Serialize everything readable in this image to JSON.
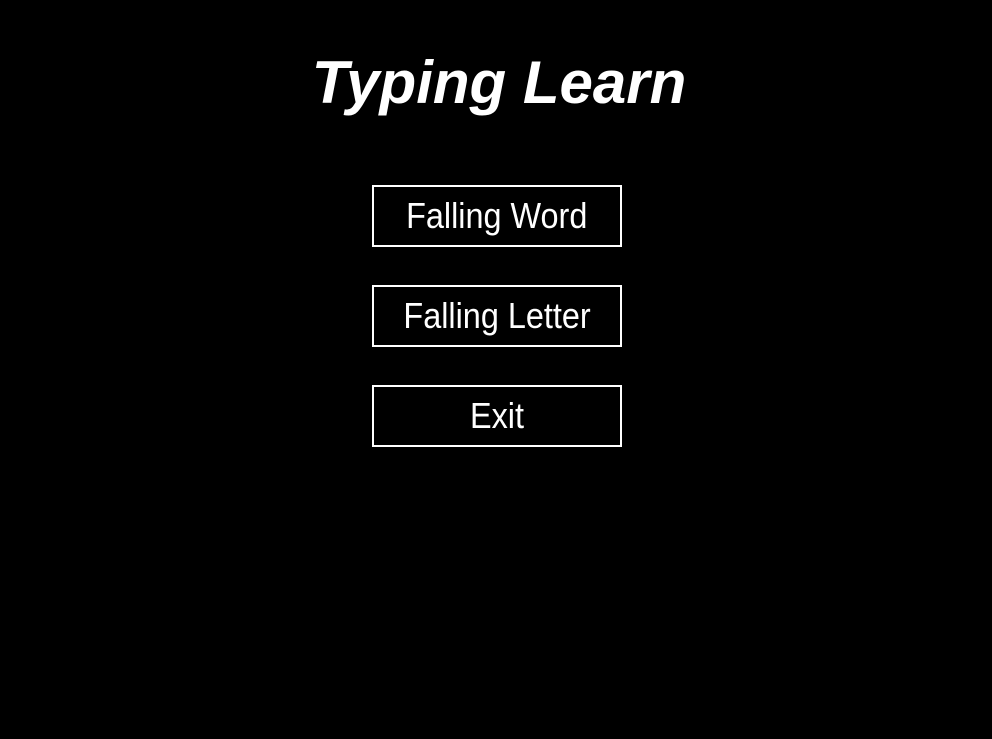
{
  "title": "Typing Learn",
  "menu": {
    "items": [
      {
        "label": "Falling Word"
      },
      {
        "label": "Falling Letter"
      },
      {
        "label": "Exit"
      }
    ]
  },
  "colors": {
    "background": "#000000",
    "foreground": "#ffffff"
  }
}
